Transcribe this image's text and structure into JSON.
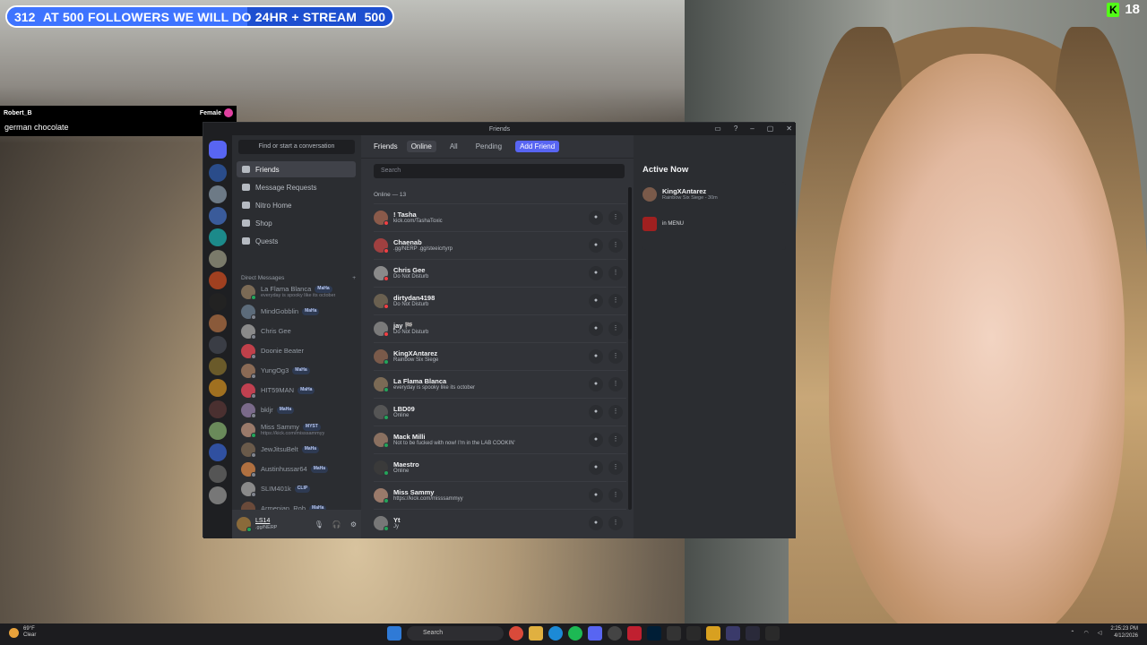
{
  "goal_bar": {
    "current": "312",
    "label": "AT 500 FOLLOWERS WE WILL DO 24HR + STREAM",
    "target": "500",
    "progress_fraction": 0.624
  },
  "kick_badge": {
    "letter": "K",
    "count": "18"
  },
  "tts_card": {
    "user": "Robert_B",
    "gender": "Female",
    "message": "german chocolate"
  },
  "window": {
    "title": "Friends",
    "controls": [
      "▭",
      "?",
      "–",
      "▢",
      "✕"
    ]
  },
  "dm_panel": {
    "find_placeholder": "Find or start a conversation",
    "nav": [
      {
        "label": "Friends",
        "icon": "friends-icon",
        "active": true
      },
      {
        "label": "Message Requests",
        "icon": "mail-icon",
        "active": false
      },
      {
        "label": "Nitro Home",
        "icon": "nitro-icon",
        "active": false
      },
      {
        "label": "Shop",
        "icon": "shop-icon",
        "active": false
      },
      {
        "label": "Quests",
        "icon": "quests-icon",
        "active": false
      }
    ],
    "section_title": "Direct Messages",
    "add_symbol": "+",
    "dms": [
      {
        "name": "La Flama Blanca",
        "tag": "MaHa",
        "sub": "everyday is spooky like its october",
        "color": "#7b6a55",
        "status": "#23a55a"
      },
      {
        "name": "MindGobblin",
        "tag": "MaHa",
        "sub": "",
        "color": "#5c6b7a",
        "status": "#80848e"
      },
      {
        "name": "Chris Gee",
        "tag": "",
        "sub": "",
        "color": "#8a8a8a",
        "status": "#80848e"
      },
      {
        "name": "Doonie Beater",
        "tag": "",
        "sub": "",
        "color": "#c0404a",
        "status": "#80848e"
      },
      {
        "name": "YungOg3",
        "tag": "MaHa",
        "sub": "",
        "color": "#8a6a55",
        "status": "#80848e"
      },
      {
        "name": "HIT59MAN",
        "tag": "MaHa",
        "sub": "",
        "color": "#c04050",
        "status": "#80848e"
      },
      {
        "name": "bkljr",
        "tag": "MaHa",
        "sub": "",
        "color": "#7a6a8a",
        "status": "#80848e"
      },
      {
        "name": "Miss Sammy",
        "tag": "MYST",
        "sub": "https://kick.com/misssammyy",
        "color": "#9a7a6a",
        "status": "#23a55a"
      },
      {
        "name": "JewJitsuBelt",
        "tag": "MaHa",
        "sub": "",
        "color": "#6a5a4a",
        "status": "#80848e"
      },
      {
        "name": "Austinhussar64",
        "tag": "MaHa",
        "sub": "",
        "color": "#b07040",
        "status": "#80848e"
      },
      {
        "name": "SLIM401k",
        "tag": "CLIP",
        "sub": "",
        "color": "#8a8a8a",
        "status": "#80848e"
      },
      {
        "name": "Armenian_Rob",
        "tag": "MaHa",
        "sub": "",
        "color": "#6a4a3a",
        "status": "#80848e"
      }
    ]
  },
  "user_bar": {
    "name": "LS14",
    "status": ".gg/NERP",
    "controls": [
      "🎙",
      "🎧",
      "⚙"
    ]
  },
  "main": {
    "tabs": {
      "friends": "Friends",
      "online": "Online",
      "all": "All",
      "pending": "Pending",
      "add": "Add Friend"
    },
    "search_placeholder": "Search",
    "online_count": "Online — 13",
    "friends": [
      {
        "name": "! Tasha",
        "sub": "kick.com/TashaToxic",
        "color": "#8a5a4a",
        "status": "#f23f43"
      },
      {
        "name": "Chaenab",
        "sub": ".gg/NERP .gg/steeicrtyrp",
        "color": "#a04040",
        "status": "#f23f43"
      },
      {
        "name": "Chris Gee",
        "sub": "Do Not Disturb",
        "color": "#8a8a8a",
        "status": "#f23f43"
      },
      {
        "name": "dirtydan4198",
        "sub": "Do Not Disturb",
        "color": "#6a6050",
        "status": "#f23f43"
      },
      {
        "name": "jay 🏁",
        "sub": "Do Not Disturb",
        "color": "#7a7a7a",
        "status": "#f23f43"
      },
      {
        "name": "KingXAntarez",
        "sub": "Rainbow Six Siege",
        "color": "#7a5a4a",
        "status": "#23a55a"
      },
      {
        "name": "La Flama Blanca",
        "sub": "everyday is spooky like its october",
        "color": "#7b6a55",
        "status": "#23a55a"
      },
      {
        "name": "LBD09",
        "sub": "Online",
        "color": "#555",
        "status": "#23a55a"
      },
      {
        "name": "Mack Milli",
        "sub": "Not to be fucked with now! I'm in the LAB COOKIN'",
        "color": "#8a7060",
        "status": "#23a55a"
      },
      {
        "name": "Maestro",
        "sub": "Online",
        "color": "#3a3a3a",
        "status": "#23a55a"
      },
      {
        "name": "Miss Sammy",
        "sub": "https://kick.com/misssammyy",
        "color": "#9a7a6a",
        "status": "#23a55a"
      },
      {
        "name": "Yt",
        "sub": "Jy",
        "color": "#777",
        "status": "#23a55a"
      }
    ]
  },
  "active_now": {
    "title": "Active Now",
    "user": "KingXAntarez",
    "activity": "Rainbow Six Siege - 30m",
    "game_state": "in MENU"
  },
  "taskbar": {
    "weather_temp": "69°F",
    "weather_desc": "Clear",
    "search_placeholder": "Search",
    "time": "2:25:23 PM",
    "date": "4/12/2026"
  }
}
